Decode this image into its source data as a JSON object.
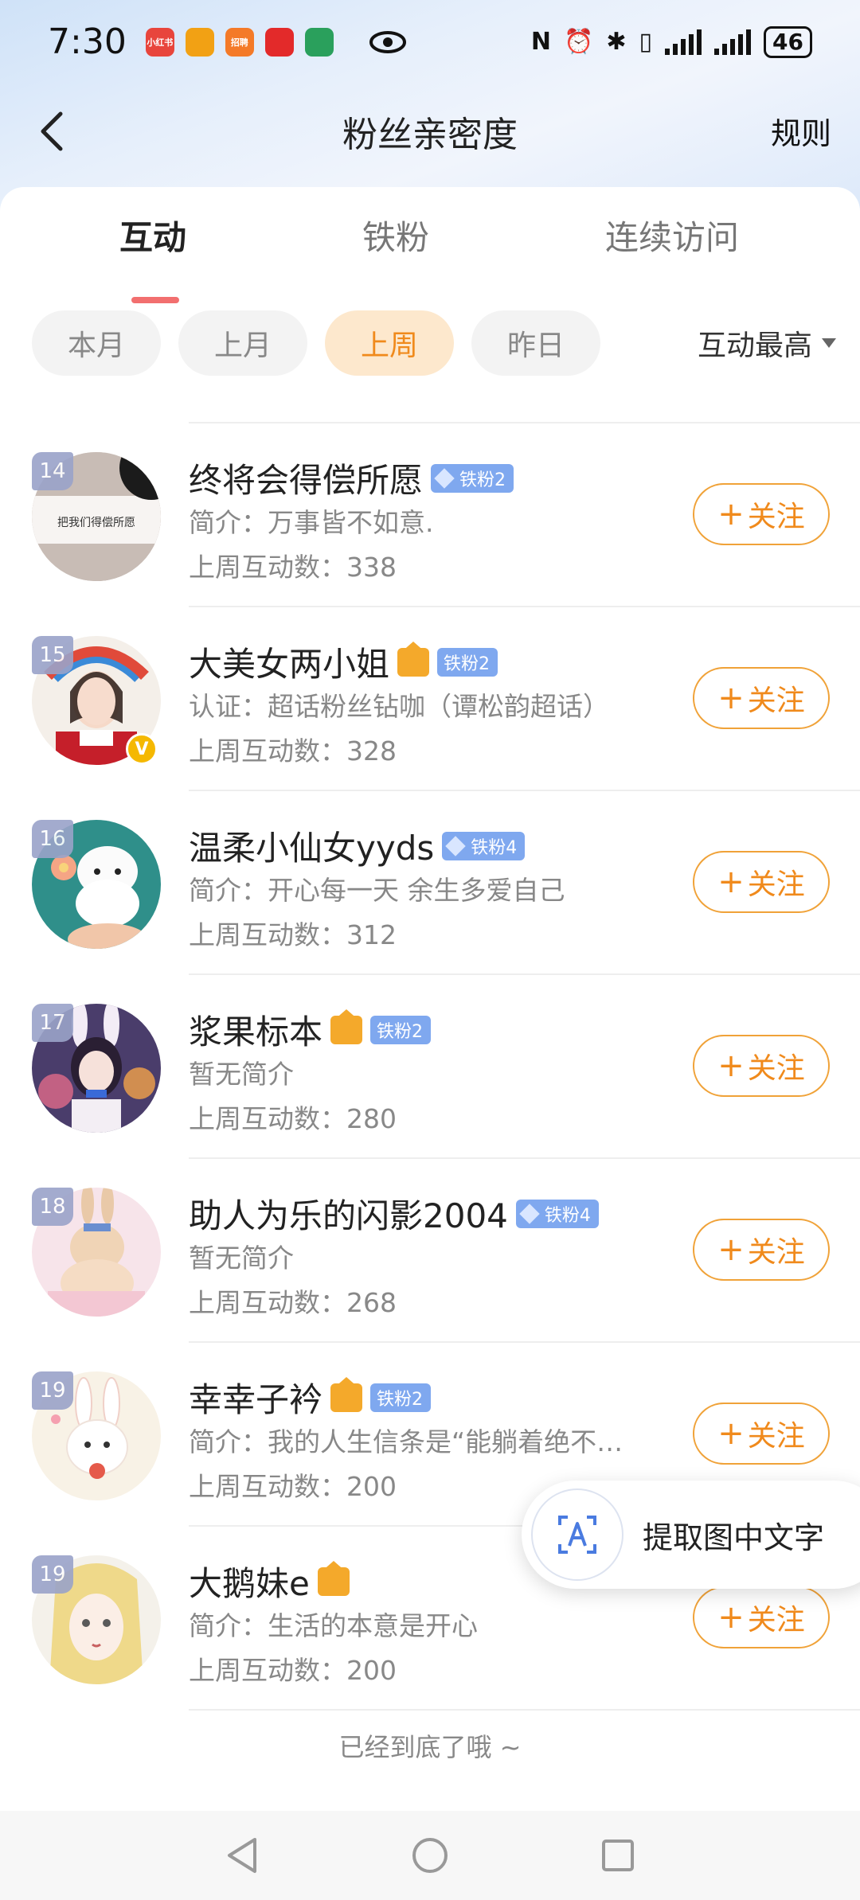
{
  "status_bar": {
    "time": "7:30",
    "battery": "46",
    "app_icons": [
      {
        "name": "xiaohongshu-icon",
        "label": "小红书",
        "color": "#e8453c"
      },
      {
        "name": "app-orange-icon",
        "label": "",
        "color": "#f2a114"
      },
      {
        "name": "zhaopin-icon",
        "label": "招聘",
        "color": "#f47a28"
      },
      {
        "name": "app-red-icon",
        "label": "",
        "color": "#e32a2a"
      },
      {
        "name": "app-green-icon",
        "label": "",
        "color": "#2aa05c"
      }
    ]
  },
  "header": {
    "title": "粉丝亲密度",
    "rules": "规则"
  },
  "tabs": [
    "互动",
    "铁粉",
    "连续访问"
  ],
  "filters": {
    "chips": [
      "本月",
      "上月",
      "上周",
      "昨日"
    ],
    "active": "上周",
    "sort": "互动最高"
  },
  "fans": [
    {
      "rank": "14",
      "name": "终将会得偿所愿",
      "badge": "铁粉2",
      "crown": false,
      "desc": "简介：万事皆不如意.",
      "count": "上周互动数：338",
      "follow": "关注",
      "verified": false
    },
    {
      "rank": "15",
      "name": "大美女两小姐",
      "badge": "铁粉2",
      "crown": true,
      "desc": "认证：超话粉丝钻咖（谭松韵超话）",
      "count": "上周互动数：328",
      "follow": "关注",
      "verified": true
    },
    {
      "rank": "16",
      "name": "温柔小仙女yyds",
      "badge": "铁粉4",
      "crown": false,
      "desc": "简介：开心每一天 余生多爱自己",
      "count": "上周互动数：312",
      "follow": "关注",
      "verified": false
    },
    {
      "rank": "17",
      "name": "浆果标本",
      "badge": "铁粉2",
      "crown": true,
      "desc": "暂无简介",
      "count": "上周互动数：280",
      "follow": "关注",
      "verified": false
    },
    {
      "rank": "18",
      "name": "助人为乐的闪影2004",
      "badge": "铁粉4",
      "crown": false,
      "desc": "暂无简介",
      "count": "上周互动数：268",
      "follow": "关注",
      "verified": false
    },
    {
      "rank": "19",
      "name": "幸幸子衿",
      "badge": "铁粉2",
      "crown": true,
      "desc": "简介：我的人生信条是“能躺着绝不…",
      "count": "上周互动数：200",
      "follow": "关注",
      "verified": false
    },
    {
      "rank": "19",
      "name": "大鹅妹e",
      "badge": "",
      "crown": true,
      "desc": "简介：生活的本意是开心",
      "count": "上周互动数：200",
      "follow": "关注",
      "verified": false
    }
  ],
  "avatar_thumb_text": "把我们得偿所愿",
  "end_text": "已经到底了哦 ~",
  "ocr_button": "提取图中文字",
  "colors": {
    "accent": "#f08a1c",
    "tab_underline": "#f26f6f",
    "fan_badge": "#7fa8ef"
  }
}
